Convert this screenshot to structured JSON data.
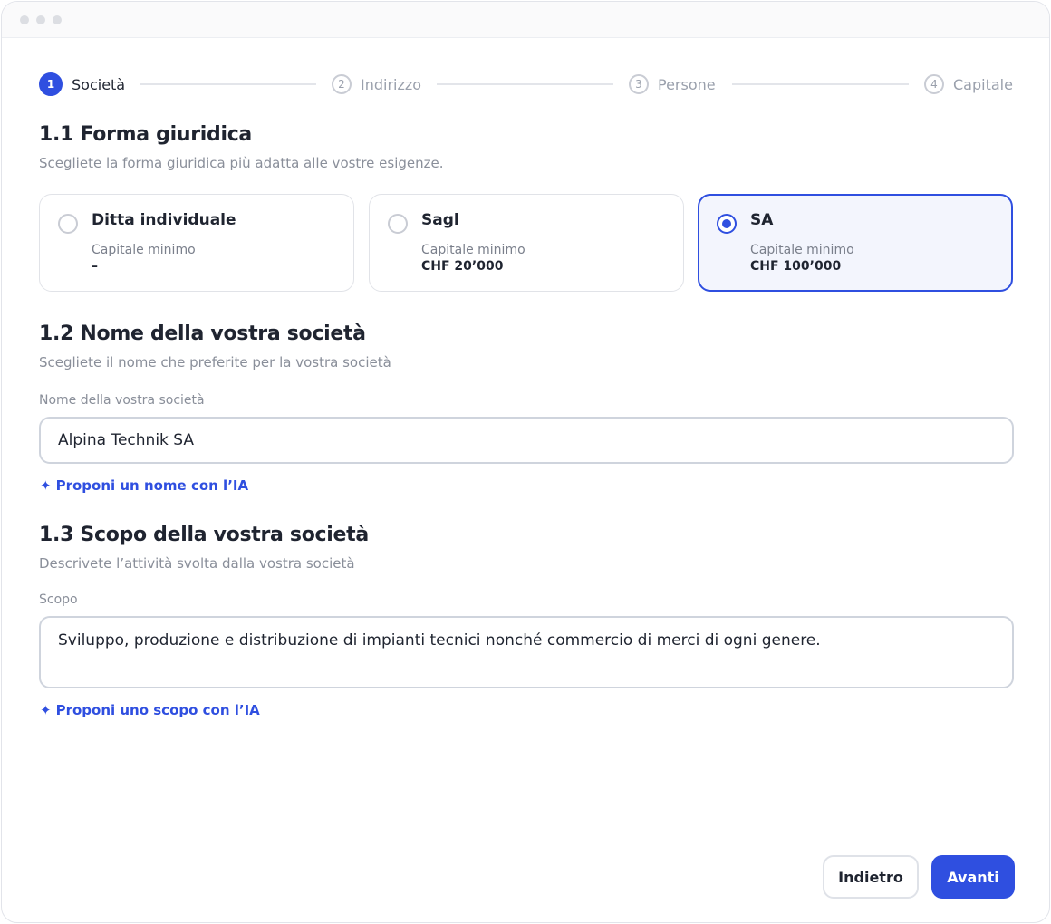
{
  "stepper": {
    "steps": [
      {
        "number": "1",
        "label": "Società",
        "active": true
      },
      {
        "number": "2",
        "label": "Indirizzo",
        "active": false
      },
      {
        "number": "3",
        "label": "Persone",
        "active": false
      },
      {
        "number": "4",
        "label": "Capitale",
        "active": false
      }
    ]
  },
  "legal_form": {
    "title": "1.1 Forma giuridica",
    "subtitle": "Scegliete la forma giuridica più adatta alle vostre esigenze.",
    "options": [
      {
        "title": "Ditta individuale",
        "capital_label": "Capitale minimo",
        "capital_value": "–",
        "selected": false
      },
      {
        "title": "Sagl",
        "capital_label": "Capitale minimo",
        "capital_value": "CHF 20’000",
        "selected": false
      },
      {
        "title": "SA",
        "capital_label": "Capitale minimo",
        "capital_value": "CHF 100’000",
        "selected": true
      }
    ]
  },
  "company_name": {
    "title": "1.2 Nome della vostra società",
    "subtitle": "Scegliete il nome che preferite per la vostra società",
    "field_label": "Nome della vostra società",
    "value": "Alpina Technik SA",
    "ai_link": "Proponi un nome con l’IA"
  },
  "purpose": {
    "title": "1.3 Scopo della vostra società",
    "subtitle": "Descrivete l’attività svolta dalla vostra società",
    "field_label": "Scopo",
    "value": "Sviluppo, produzione e distribuzione di impianti tecnici nonché commercio di merci di ogni genere.",
    "ai_link": "Proponi uno scopo con l’IA"
  },
  "footer": {
    "back_label": "Indietro",
    "next_label": "Avanti"
  },
  "icons": {
    "spark": "✦"
  },
  "colors": {
    "accent": "#2f4fe0",
    "selected_bg": "#f3f5fd",
    "muted_text": "#8a8f9a"
  }
}
